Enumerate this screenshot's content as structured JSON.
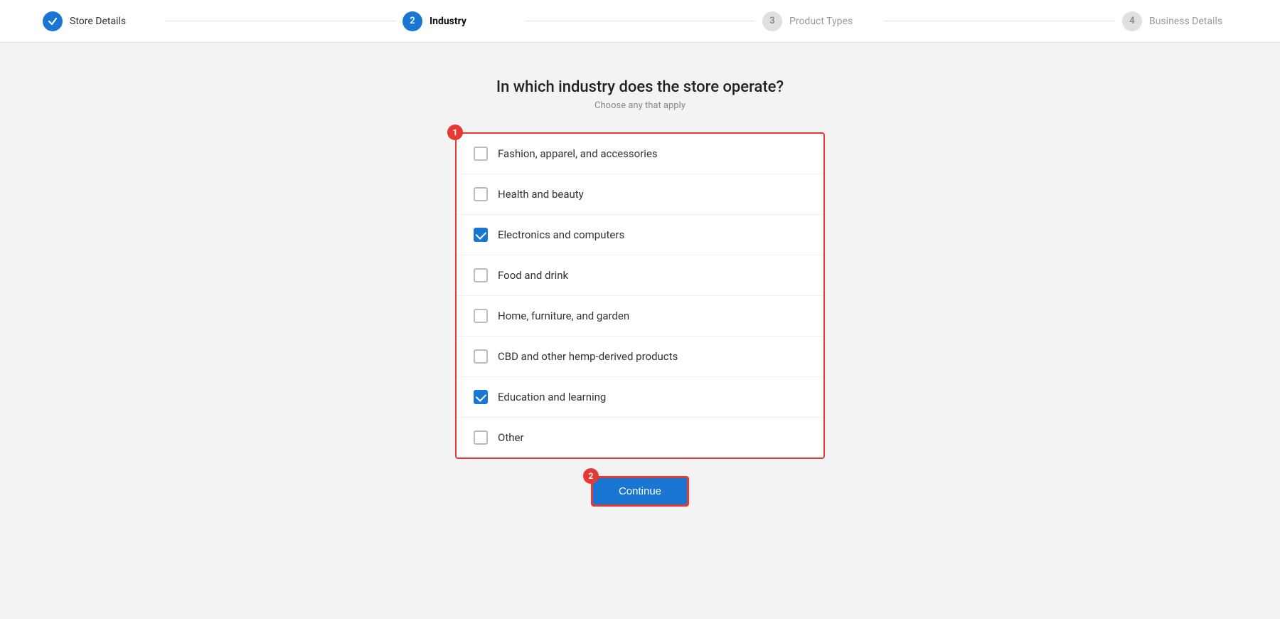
{
  "stepper": {
    "steps": [
      {
        "id": "store-details",
        "number": "✓",
        "label": "Store Details",
        "state": "done"
      },
      {
        "id": "industry",
        "number": "2",
        "label": "Industry",
        "state": "active"
      },
      {
        "id": "product-types",
        "number": "3",
        "label": "Product Types",
        "state": "inactive"
      },
      {
        "id": "business-details",
        "number": "4",
        "label": "Business Details",
        "state": "inactive"
      }
    ]
  },
  "page": {
    "title": "In which industry does the store operate?",
    "subtitle": "Choose any that apply"
  },
  "annotation1": "1",
  "annotation2": "2",
  "checklist": {
    "items": [
      {
        "id": "fashion",
        "label": "Fashion, apparel, and accessories",
        "checked": false
      },
      {
        "id": "health",
        "label": "Health and beauty",
        "checked": false
      },
      {
        "id": "electronics",
        "label": "Electronics and computers",
        "checked": true
      },
      {
        "id": "food",
        "label": "Food and drink",
        "checked": false
      },
      {
        "id": "home",
        "label": "Home, furniture, and garden",
        "checked": false
      },
      {
        "id": "cbd",
        "label": "CBD and other hemp-derived products",
        "checked": false
      },
      {
        "id": "education",
        "label": "Education and learning",
        "checked": true
      },
      {
        "id": "other",
        "label": "Other",
        "checked": false
      }
    ]
  },
  "continue_button": "Continue"
}
